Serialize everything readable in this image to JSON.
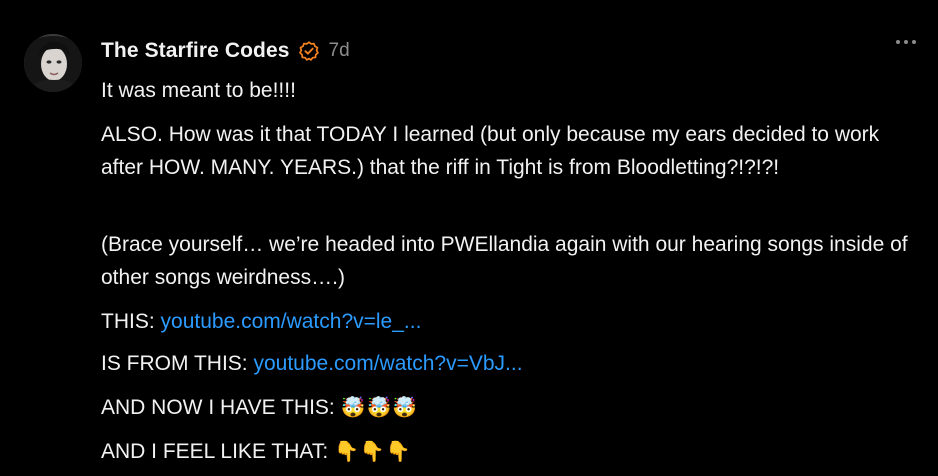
{
  "post": {
    "author": "The Starfire Codes",
    "timestamp": "7d",
    "paragraphs": {
      "line1": "It was meant to be!!!!",
      "line2": "ALSO. How was it that TODAY I learned (but only because my ears decided to work after HOW. MANY. YEARS.) that the riff in Tight is from Bloodletting?!?!?!",
      "line3": "(Brace yourself… we’re headed into PWEllandia again with our hearing songs inside of other songs weirdness….)",
      "line4_prefix": "THIS: ",
      "line4_link": "youtube.com/watch?v=le_...",
      "line5_prefix": "IS FROM THIS: ",
      "line5_link": "youtube.com/watch?v=VbJ...",
      "line6_prefix": "AND NOW I HAVE THIS: ",
      "line6_emoji": "🤯🤯🤯",
      "line7_prefix": "AND I FEEL LIKE THAT: ",
      "line7_emoji": "👇👇👇"
    }
  },
  "icons": {
    "verified": "verified-check-icon",
    "more": "more-options-icon"
  },
  "colors": {
    "background": "#000000",
    "text": "#f2f2f2",
    "muted": "#8c8c8c",
    "link": "#2b9bff",
    "verified": "#f5821f"
  }
}
